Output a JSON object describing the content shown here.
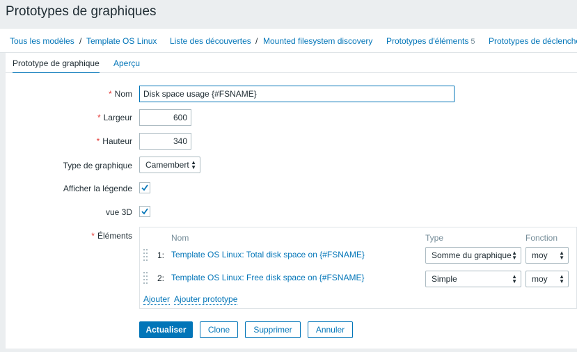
{
  "page": {
    "title": "Prototypes de graphiques"
  },
  "breadcrumb": {
    "items": [
      "Tous les modèles",
      "Template OS Linux",
      "Liste des découvertes",
      "Mounted filesystem discovery",
      "Prototypes d'éléments",
      "Prototypes de déclenche"
    ],
    "item_prototypes_count": "5",
    "separator": "/"
  },
  "tabs": [
    "Prototype de graphique",
    "Aperçu"
  ],
  "form": {
    "name": {
      "label": "Nom",
      "value": "Disk space usage {#FSNAME}"
    },
    "width": {
      "label": "Largeur",
      "value": "600"
    },
    "height": {
      "label": "Hauteur",
      "value": "340"
    },
    "graph_type": {
      "label": "Type de graphique",
      "value": "Camembert"
    },
    "show_legend": {
      "label": "Afficher la légende",
      "checked": true
    },
    "view_3d": {
      "label": "vue 3D",
      "checked": true
    },
    "elements": {
      "label": "Éléments",
      "columns": {
        "name": "Nom",
        "type": "Type",
        "function": "Fonction"
      },
      "items": [
        {
          "num": "1:",
          "name": "Template OS Linux: Total disk space on {#FSNAME}",
          "type": "Somme du graphique",
          "function": "moy"
        },
        {
          "num": "2:",
          "name": "Template OS Linux: Free disk space on {#FSNAME}",
          "type": "Simple",
          "function": "moy"
        }
      ],
      "add_label": "Ajouter",
      "add_prototype_label": "Ajouter prototype"
    }
  },
  "buttons": {
    "update": "Actualiser",
    "clone": "Clone",
    "delete": "Supprimer",
    "cancel": "Annuler"
  },
  "colors": {
    "accent": "#0275b8",
    "required": "#e33734",
    "background": "#ebeef0"
  }
}
